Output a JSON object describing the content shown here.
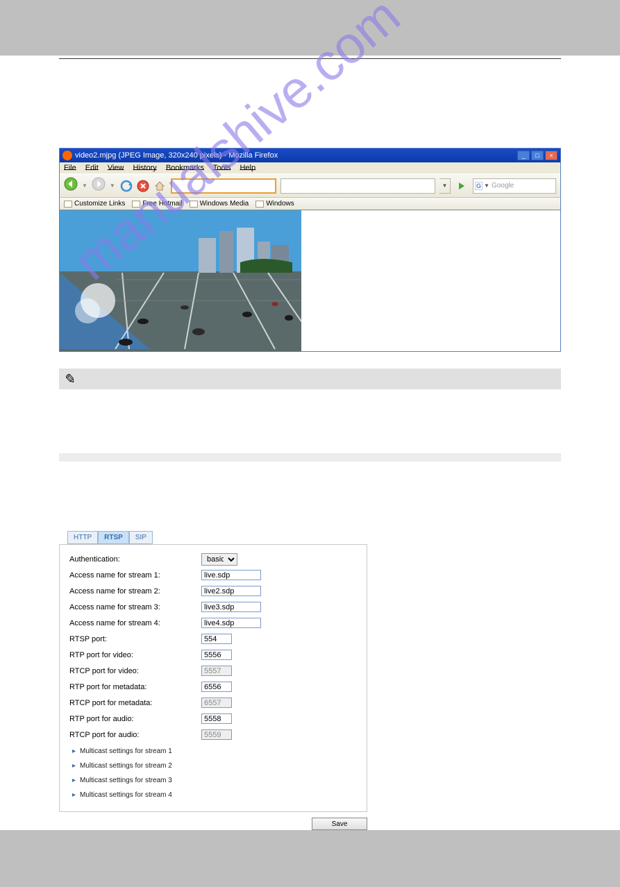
{
  "browser": {
    "title": "video2.mjpg (JPEG Image, 320x240 pixels) - Mozilla Firefox",
    "menus": [
      "File",
      "Edit",
      "View",
      "History",
      "Bookmarks",
      "Tools",
      "Help"
    ],
    "search_placeholder": "Google",
    "bookmarks": [
      "Customize Links",
      "Free Hotmail",
      "Windows Media",
      "Windows"
    ]
  },
  "tabs": {
    "http": "HTTP",
    "rtsp": "RTSP",
    "sip": "SIP"
  },
  "form": {
    "auth_label": "Authentication:",
    "auth_value": "basic",
    "stream1_label": "Access name for stream 1:",
    "stream1_value": "live.sdp",
    "stream2_label": "Access name for stream 2:",
    "stream2_value": "live2.sdp",
    "stream3_label": "Access name for stream 3:",
    "stream3_value": "live3.sdp",
    "stream4_label": "Access name for stream 4:",
    "stream4_value": "live4.sdp",
    "rtsp_port_label": "RTSP port:",
    "rtsp_port_value": "554",
    "rtp_video_label": "RTP port for video:",
    "rtp_video_value": "5556",
    "rtcp_video_label": "RTCP port for video:",
    "rtcp_video_value": "5557",
    "rtp_meta_label": "RTP port for metadata:",
    "rtp_meta_value": "6556",
    "rtcp_meta_label": "RTCP port for metadata:",
    "rtcp_meta_value": "6557",
    "rtp_audio_label": "RTP port for audio:",
    "rtp_audio_value": "5558",
    "rtcp_audio_label": "RTCP port for audio:",
    "rtcp_audio_value": "5559",
    "mc1": "Multicast settings for stream 1",
    "mc2": "Multicast settings for stream 2",
    "mc3": "Multicast settings for stream 3",
    "mc4": "Multicast settings for stream 4",
    "save": "Save"
  },
  "watermark": "manualshive.com"
}
